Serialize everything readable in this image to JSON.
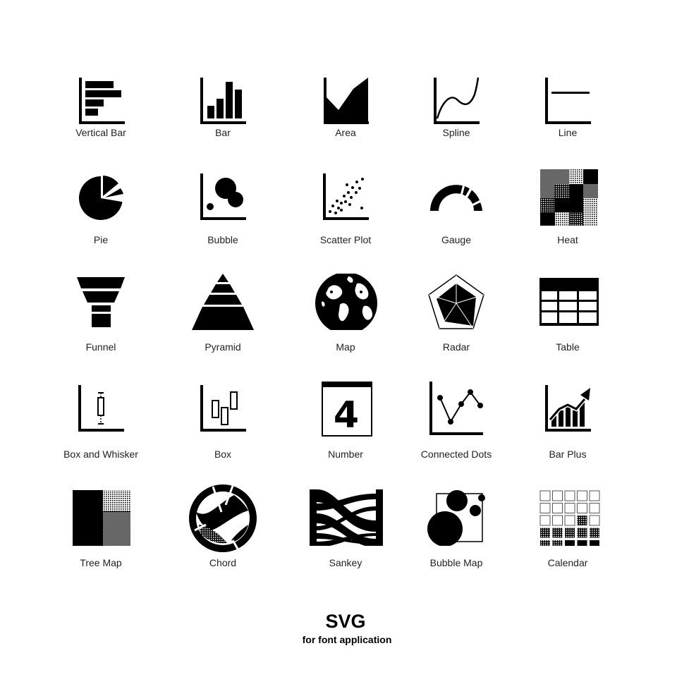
{
  "icons": [
    {
      "label": "Vertical Bar",
      "icon": "vertical-bar-chart-icon"
    },
    {
      "label": "Bar",
      "icon": "bar-chart-icon"
    },
    {
      "label": "Area",
      "icon": "area-chart-icon"
    },
    {
      "label": "Spline",
      "icon": "spline-chart-icon"
    },
    {
      "label": "Line",
      "icon": "line-chart-icon"
    },
    {
      "label": "Pie",
      "icon": "pie-chart-icon"
    },
    {
      "label": "Bubble",
      "icon": "bubble-chart-icon"
    },
    {
      "label": "Scatter Plot",
      "icon": "scatter-plot-icon"
    },
    {
      "label": "Gauge",
      "icon": "gauge-icon"
    },
    {
      "label": "Heat",
      "icon": "heat-map-icon"
    },
    {
      "label": "Funnel",
      "icon": "funnel-icon"
    },
    {
      "label": "Pyramid",
      "icon": "pyramid-icon"
    },
    {
      "label": "Map",
      "icon": "globe-map-icon"
    },
    {
      "label": "Radar",
      "icon": "radar-chart-icon"
    },
    {
      "label": "Table",
      "icon": "table-icon"
    },
    {
      "label": "Box and Whisker",
      "icon": "box-and-whisker-icon"
    },
    {
      "label": "Box",
      "icon": "box-chart-icon"
    },
    {
      "label": "Number",
      "icon": "number-icon",
      "number_value": "4"
    },
    {
      "label": "Connected Dots",
      "icon": "connected-dots-icon"
    },
    {
      "label": "Bar Plus",
      "icon": "bar-plus-icon"
    },
    {
      "label": "Tree Map",
      "icon": "tree-map-icon"
    },
    {
      "label": "Chord",
      "icon": "chord-diagram-icon"
    },
    {
      "label": "Sankey",
      "icon": "sankey-diagram-icon"
    },
    {
      "label": "Bubble Map",
      "icon": "bubble-map-icon"
    },
    {
      "label": "Calendar",
      "icon": "calendar-icon"
    }
  ],
  "footer": {
    "title": "SVG",
    "subtitle": "for font application"
  },
  "colors": {
    "ink": "#000000",
    "background": "#ffffff",
    "label": "#222222"
  }
}
